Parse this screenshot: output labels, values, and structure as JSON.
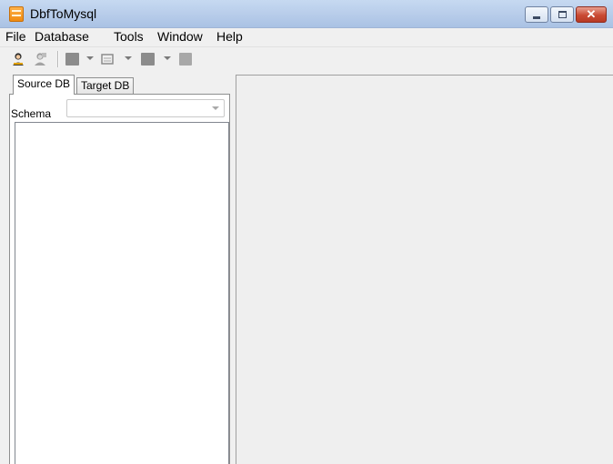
{
  "window": {
    "title": "DbfToMysql",
    "app_icon": "dbf-app-icon",
    "controls": [
      "minimize-icon",
      "maximize-icon",
      "close-icon"
    ]
  },
  "menubar": {
    "items": [
      {
        "label": "File"
      },
      {
        "label": "Database"
      },
      {
        "label": "Tools"
      },
      {
        "label": "Window"
      },
      {
        "label": "Help"
      }
    ]
  },
  "toolbar": {
    "buttons": [
      {
        "icon": "connect-user-icon",
        "enabled": true
      },
      {
        "icon": "disconnect-user-icon",
        "enabled": false
      },
      {
        "icon": "table-icon",
        "enabled": false,
        "dropdown": true
      },
      {
        "icon": "image-icon",
        "enabled": false,
        "dropdown": true
      },
      {
        "icon": "grid-icon",
        "enabled": false,
        "dropdown": true
      },
      {
        "icon": "stop-icon",
        "enabled": false
      }
    ]
  },
  "left_panel": {
    "tabs": [
      {
        "label": "Source DB",
        "active": true
      },
      {
        "label": "Target DB",
        "active": false
      }
    ],
    "schema": {
      "label": "Schema",
      "value": ""
    }
  },
  "colors": {
    "titlebar": "#b9cde9",
    "window_bg": "#f0f0f0",
    "close_button": "#c94a33"
  }
}
